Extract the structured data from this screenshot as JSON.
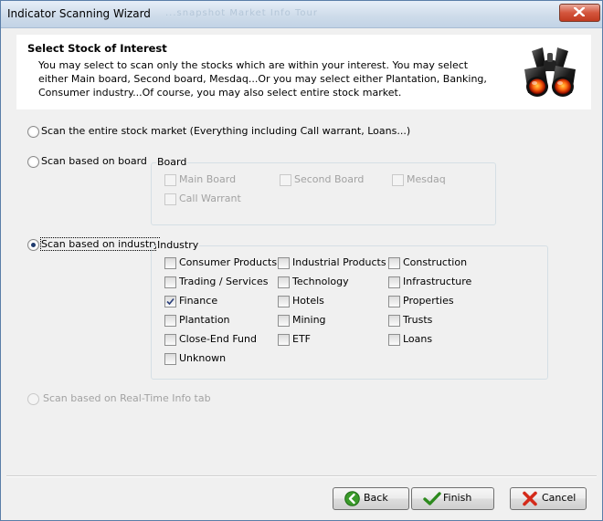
{
  "window": {
    "title": "Indicator Scanning Wizard",
    "faint_title": "...snapshot   Market Info Tour"
  },
  "header": {
    "title": "Select Stock of Interest",
    "description": "You may select to scan only the stocks which are within your interest. You may select either Main board, Second board, Mesdaq...Or you may select either Plantation, Banking, Consumer industry...Of course, you may also select entire stock market."
  },
  "options": {
    "entire_market": {
      "label": "Scan the entire stock market (Everything including Call warrant, Loans...)",
      "selected": false
    },
    "board": {
      "label": "Scan based on board",
      "selected": false
    },
    "industry": {
      "label": "Scan based on industry",
      "selected": true
    },
    "realtime": {
      "label": "Scan based on Real-Time Info tab",
      "selected": false,
      "enabled": false
    }
  },
  "board_group": {
    "title": "Board",
    "items": [
      {
        "label": "Main Board",
        "checked": false,
        "enabled": false
      },
      {
        "label": "Second Board",
        "checked": false,
        "enabled": false
      },
      {
        "label": "Mesdaq",
        "checked": false,
        "enabled": false
      },
      {
        "label": "Call Warrant",
        "checked": false,
        "enabled": false
      }
    ]
  },
  "industry_group": {
    "title": "Industry",
    "items": [
      {
        "label": "Consumer Products",
        "checked": false
      },
      {
        "label": "Industrial Products",
        "checked": false
      },
      {
        "label": "Construction",
        "checked": false
      },
      {
        "label": "Trading / Services",
        "checked": false
      },
      {
        "label": "Technology",
        "checked": false
      },
      {
        "label": "Infrastructure",
        "checked": false
      },
      {
        "label": "Finance",
        "checked": true
      },
      {
        "label": "Hotels",
        "checked": false
      },
      {
        "label": "Properties",
        "checked": false
      },
      {
        "label": "Plantation",
        "checked": false
      },
      {
        "label": "Mining",
        "checked": false
      },
      {
        "label": "Trusts",
        "checked": false
      },
      {
        "label": "Close-End Fund",
        "checked": false
      },
      {
        "label": "ETF",
        "checked": false
      },
      {
        "label": "Loans",
        "checked": false
      },
      {
        "label": "Unknown",
        "checked": false
      }
    ]
  },
  "buttons": {
    "back": {
      "label": "Back",
      "icon": "back-arrow-icon"
    },
    "finish": {
      "label": "Finish",
      "icon": "checkmark-icon"
    },
    "cancel": {
      "label": "Cancel",
      "icon": "red-x-icon"
    }
  },
  "colors": {
    "accent_green": "#3a9a2a",
    "cancel_red": "#d42a1a",
    "selection_dot": "#1e3a6e"
  }
}
